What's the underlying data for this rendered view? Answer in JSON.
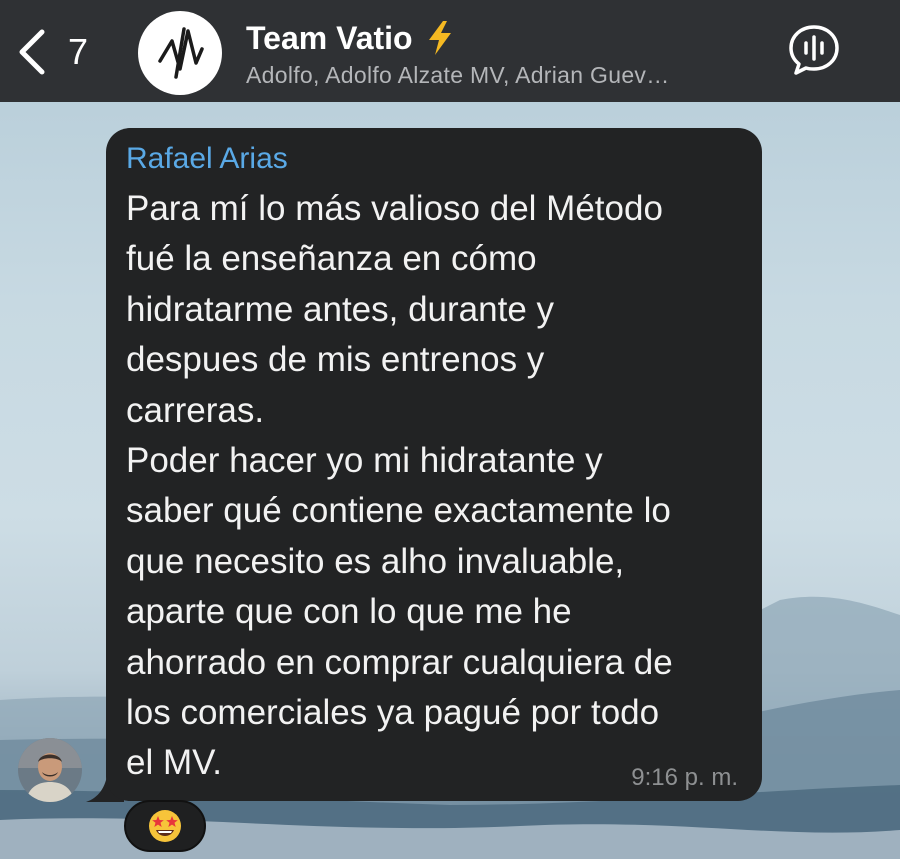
{
  "header": {
    "back_count": "7",
    "title": "Team Vatio",
    "members": "Adolfo, Adolfo Alzate MV, Adrian Guev…",
    "icons": {
      "back": "chevron-left-icon",
      "group_avatar": "vatio-logo-icon",
      "title_emoji": "lightning-bolt-icon",
      "voice_chat": "voice-chat-icon"
    }
  },
  "message": {
    "sender": "Rafael Arias",
    "text": "Para mí lo más valioso del Método\nfué la enseñanza en cómo\nhidratarme antes, durante y\ndespues de mis entrenos y\ncarreras.\nPoder hacer yo mi hidratante y\nsaber qué contiene exactamente lo\nque necesito es alho invaluable,\naparte que con lo que me he\nahorrado en comprar cualquiera de\nlos comerciales ya pagué por todo\nel MV.",
    "time": "9:16 p. m.",
    "reaction_icon": "star-struck-emoji-icon"
  },
  "colors": {
    "header_bg": "#2f3134",
    "bubble_bg": "#222324",
    "sender_name": "#5aa9e6",
    "bolt": "#f5b922"
  }
}
